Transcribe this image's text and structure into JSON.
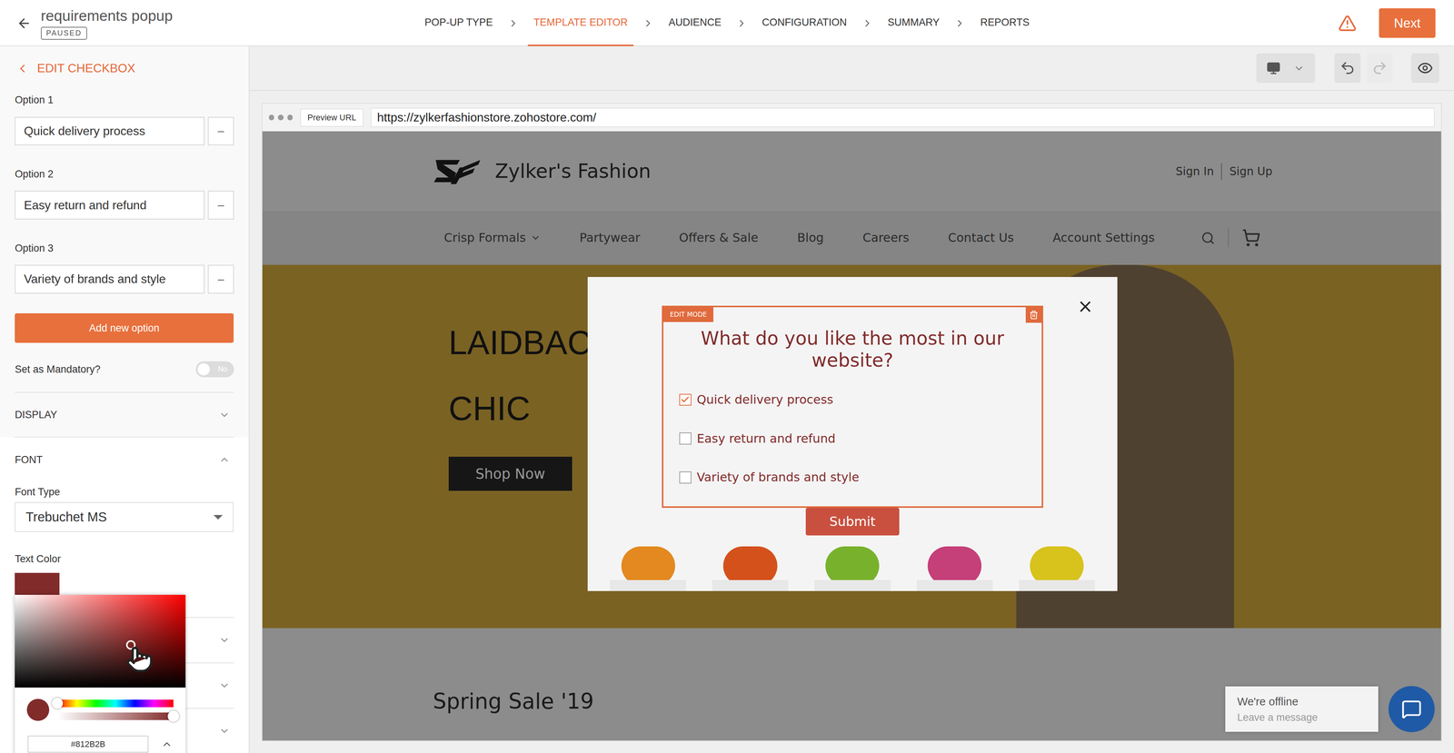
{
  "header": {
    "title": "requirements popup",
    "status": "PAUSED",
    "steps": [
      {
        "label": "POP-UP TYPE",
        "selected": false
      },
      {
        "label": "TEMPLATE EDITOR",
        "selected": true
      },
      {
        "label": "AUDIENCE",
        "selected": false
      },
      {
        "label": "CONFIGURATION",
        "selected": false
      },
      {
        "label": "SUMMARY",
        "selected": false
      },
      {
        "label": "REPORTS",
        "selected": false
      }
    ],
    "next": "Next"
  },
  "toolbar": {
    "undo_enabled": true,
    "redo_enabled": false
  },
  "panel": {
    "title": "EDIT CHECKBOX",
    "options": [
      {
        "label": "Option 1",
        "value": "Quick delivery process",
        "remove": "–"
      },
      {
        "label": "Option 2",
        "value": "Easy return and refund",
        "remove": "–"
      },
      {
        "label": "Option 3",
        "value": "Variety of brands and style",
        "remove": "–"
      }
    ],
    "add_option": "Add new option",
    "mandatory": {
      "label": "Set as Mandatory?",
      "on": false,
      "state": "No"
    },
    "sections": [
      {
        "label": "DISPLAY",
        "expanded": false
      },
      {
        "label": "FONT",
        "expanded": true
      }
    ],
    "font": {
      "type_label": "Font Type",
      "type": "Trebuchet MS",
      "color_label": "Text Color",
      "color": "#812B2B"
    },
    "color_picker": {
      "open": true,
      "hue_level": 0,
      "saturation": 0.68,
      "value": 0.46,
      "alpha_level": 1,
      "hex": "#812B2B"
    },
    "more_sections": [
      {
        "expanded": false
      },
      {
        "expanded": false
      },
      {
        "expanded": false
      }
    ]
  },
  "preview": {
    "url_label": "Preview URL",
    "url": "https://zylkerfashionstore.zohostore.com/"
  },
  "site": {
    "brand": "Zylker's Fashion",
    "auth": [
      "Sign In",
      "Sign Up"
    ],
    "nav": [
      {
        "label": "Crisp Formals",
        "dropdown": true
      },
      {
        "label": "Partywear",
        "dropdown": false
      },
      {
        "label": "Offers & Sale",
        "dropdown": false
      },
      {
        "label": "Blog",
        "dropdown": false
      },
      {
        "label": "Careers",
        "dropdown": false
      },
      {
        "label": "Contact Us",
        "dropdown": false
      },
      {
        "label": "Account Settings",
        "dropdown": false
      }
    ],
    "hero": {
      "lines": [
        "LAIDBAC",
        "CHIC"
      ],
      "button": "Shop Now"
    },
    "section_title": "Spring Sale '19",
    "chat": {
      "status": "We're offline",
      "action": "Leave a message"
    }
  },
  "popup": {
    "edit_tag": "EDIT MODE",
    "question": "What do you like the most in our website?",
    "choices": [
      {
        "label": "Quick delivery process",
        "checked": true
      },
      {
        "label": "Easy return and refund",
        "checked": false
      },
      {
        "label": "Variety of brands and style",
        "checked": false
      }
    ],
    "submit": "Submit",
    "close": "×"
  }
}
